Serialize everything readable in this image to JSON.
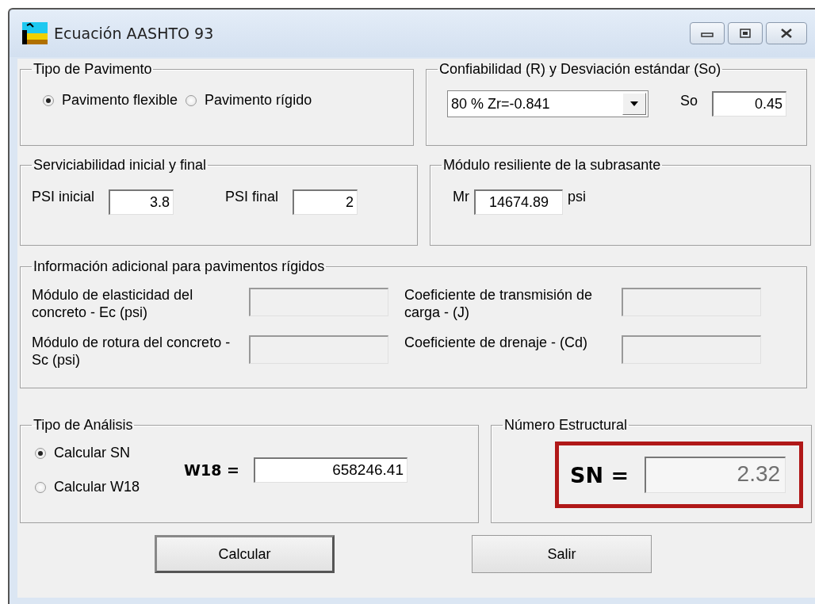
{
  "window": {
    "title": "Ecuación AASHTO 93"
  },
  "pavement_type": {
    "legend": "Tipo de Pavimento",
    "options": [
      {
        "label": "Pavimento flexible",
        "selected": true
      },
      {
        "label": "Pavimento rígido",
        "selected": false
      }
    ]
  },
  "reliability": {
    "legend": "Confiabilidad (R) y Desviación estándar (So)",
    "dropdown_value": "80 % Zr=-0.841",
    "so_label": "So",
    "so_value": "0.45"
  },
  "serviceability": {
    "legend": "Serviciabilidad inicial y final",
    "fields": [
      {
        "label": "PSI inicial",
        "value": "3.8"
      },
      {
        "label": "PSI final",
        "value": "2"
      }
    ]
  },
  "resilient_modulus": {
    "legend": "Módulo resiliente de la subrasante",
    "label": "Mr",
    "value": "14674.89",
    "unit": "psi"
  },
  "rigid_info": {
    "legend": "Información adicional para pavimentos rígidos",
    "fields": [
      {
        "label": "Módulo de elasticidad del concreto - Ec (psi)",
        "disabled": true
      },
      {
        "label": "Coeficiente de transmisión de carga - (J)",
        "disabled": true
      },
      {
        "label": "Módulo de rotura del concreto - Sc (psi)",
        "disabled": true
      },
      {
        "label": "Coeficiente de drenaje - (Cd)",
        "disabled": true
      }
    ]
  },
  "analysis": {
    "legend": "Tipo de Análisis",
    "options": [
      {
        "label": "Calcular SN",
        "selected": true
      },
      {
        "label": "Calcular W18",
        "selected": false
      }
    ],
    "w18_label": "W18 =",
    "w18_value": "658246.41"
  },
  "structural_number": {
    "legend": "Número Estructural",
    "label": "SN =",
    "value": "2.32"
  },
  "buttons": [
    {
      "label": "Calcular",
      "default": true
    },
    {
      "label": "Salir",
      "default": false
    }
  ]
}
